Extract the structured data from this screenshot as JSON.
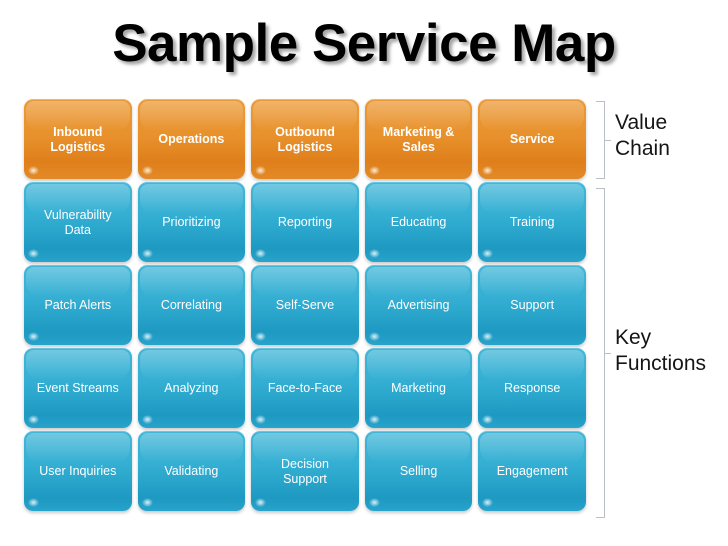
{
  "title": "Sample Service Map",
  "colors": {
    "orange_top": "#eb9a37",
    "orange_bottom": "#df7f1b",
    "blue_top": "#41b6d8",
    "blue_bottom": "#1d99c2",
    "bracket": "#b9bfc4",
    "title_text": "#000000",
    "cell_text": "#ffffff",
    "label_text": "#151515"
  },
  "matrix": {
    "rows": [
      {
        "style": "orange",
        "cells": [
          "Inbound\nLogistics",
          "Operations",
          "Outbound\nLogistics",
          "Marketing &\nSales",
          "Service"
        ]
      },
      {
        "style": "blue",
        "cells": [
          "Vulnerability\nData",
          "Prioritizing",
          "Reporting",
          "Educating",
          "Training"
        ]
      },
      {
        "style": "blue",
        "cells": [
          "Patch Alerts",
          "Correlating",
          "Self-Serve",
          "Advertising",
          "Support"
        ]
      },
      {
        "style": "blue",
        "cells": [
          "Event Streams",
          "Analyzing",
          "Face-to-Face",
          "Marketing",
          "Response"
        ]
      },
      {
        "style": "blue",
        "cells": [
          "User Inquiries",
          "Validating",
          "Decision\nSupport",
          "Selling",
          "Engagement"
        ]
      }
    ]
  },
  "groups": {
    "value_chain": "Value\nChain",
    "key_functions": "Key\nFunctions"
  }
}
